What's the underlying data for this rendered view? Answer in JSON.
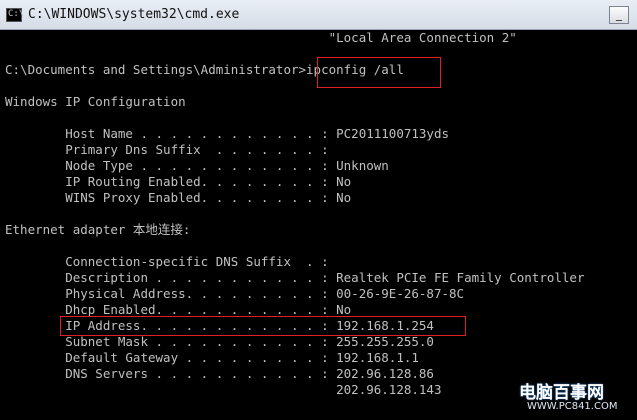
{
  "window": {
    "title": "C:\\WINDOWS\\system32\\cmd.exe",
    "minimize_label": "_"
  },
  "console": {
    "lines": [
      "                                           \"Local Area Connection 2\"",
      "",
      "C:\\Documents and Settings\\Administrator>ipconfig /all",
      "",
      "Windows IP Configuration",
      "",
      "        Host Name . . . . . . . . . . . . : PC2011100713yds",
      "        Primary Dns Suffix  . . . . . . . :",
      "        Node Type . . . . . . . . . . . . : Unknown",
      "        IP Routing Enabled. . . . . . . . : No",
      "        WINS Proxy Enabled. . . . . . . . : No",
      "",
      "Ethernet adapter 本地连接:",
      "",
      "        Connection-specific DNS Suffix  . :",
      "        Description . . . . . . . . . . . : Realtek PCIe FE Family Controller",
      "        Physical Address. . . . . . . . . : 00-26-9E-26-87-8C",
      "        Dhcp Enabled. . . . . . . . . . . : No",
      "        IP Address. . . . . . . . . . . . : 192.168.1.254",
      "        Subnet Mask . . . . . . . . . . . : 255.255.255.0",
      "        Default Gateway . . . . . . . . . : 192.168.1.1",
      "        DNS Servers . . . . . . . . . . . : 202.96.128.86",
      "                                            202.96.128.143"
    ]
  },
  "watermark": {
    "name": "电脑百事网",
    "url": "WWW.PC841.COM"
  },
  "colors": {
    "console_bg": "#000000",
    "console_text": "#c0c0c0",
    "highlight": "#e02020"
  }
}
